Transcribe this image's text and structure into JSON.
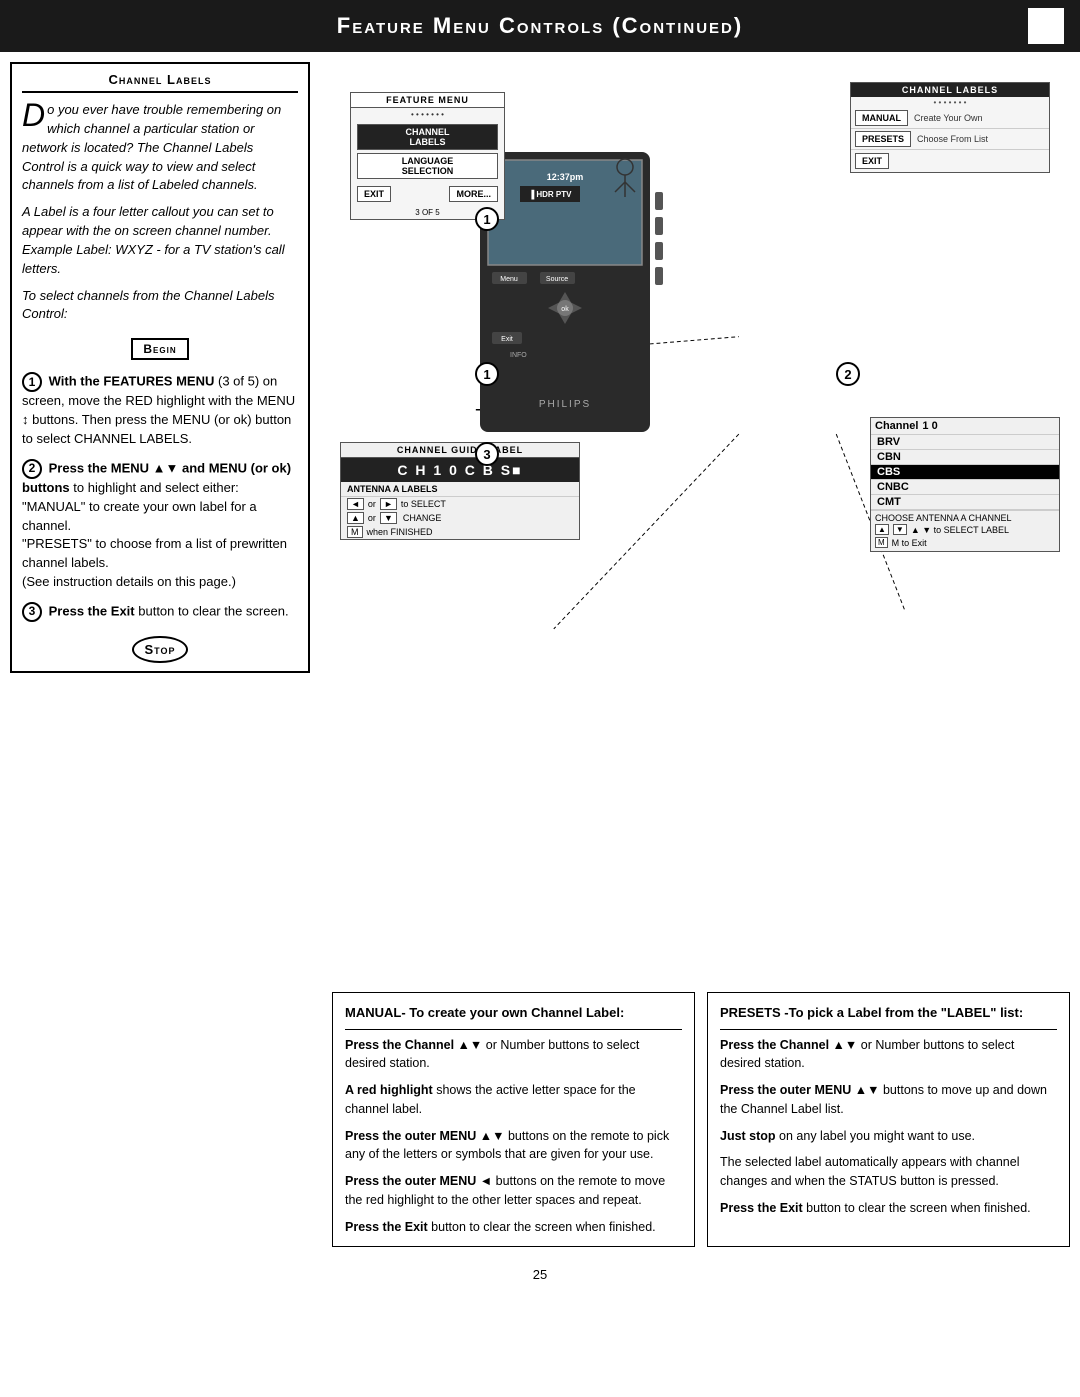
{
  "header": {
    "title": "Feature Menu Controls (Continued)",
    "corner": ""
  },
  "channel_labels_section": {
    "title": "Channel Labels",
    "intro_paragraph": "o you ever have trouble remembering on which channel a particular station or network is located? The Channel Labels Control is a quick way to view and select channels from a list of Labeled channels.",
    "intro_drop_cap": "D",
    "label_paragraph": "A Label is a four letter callout you can set to appear with the on screen channel number. Example Label: WXYZ - for a TV station's call letters.",
    "select_paragraph": "To select channels from the Channel Labels Control:",
    "begin_label": "Begin",
    "step1_header": "With the FEATURES MENU",
    "step1_text": "(3 of 5) on screen, move the RED highlight with the MENU ↕ buttons. Then press the MENU (or ok) button to select  CHANNEL LABELS.",
    "step2_header": "Press the MENU ▲▼ and MENU (or ok) buttons",
    "step2_text": " to highlight and select either:",
    "step2_manual": "\"MANUAL\" to create your own label for a channel.",
    "step2_presets": "\"PRESETS\" to choose from a list of prewritten channel labels.",
    "step2_note": "(See instruction details on this page.)",
    "step3_header": "Press the Exit",
    "step3_text": " button to clear the screen.",
    "stop_label": "Stop"
  },
  "feature_menu": {
    "title": "FEATURE MENU",
    "dots": "• • • • • • •",
    "items": [
      {
        "label": "CHANNEL\nLABELS",
        "selected": true
      },
      {
        "label": "LANGUAGE\nSELECTION",
        "selected": false
      }
    ],
    "exit_btn": "EXIT",
    "more_btn": "MORE...",
    "page_info": "3 OF 5"
  },
  "channel_labels_panel": {
    "title": "CHANNEL LABELS",
    "dots": "• • • • • • •",
    "manual_btn": "MANUAL",
    "manual_desc": "Create Your Own",
    "presets_btn": "PRESETS",
    "presets_desc": "Choose From List",
    "exit_btn": "EXIT"
  },
  "channel_guide": {
    "title": "CHANNEL GUIDE LABEL",
    "channel_display": "C H 1 0  C B S■",
    "antenna_label": "ANTENNA A LABELS",
    "instructions": [
      {
        "arrows": "◄ or ►",
        "action": "to SELECT"
      },
      {
        "arrows": "▲ or ▼",
        "action": "to CHANGE"
      },
      {
        "key": "M",
        "action": "when FINISHED"
      }
    ]
  },
  "presets_panel": {
    "channel_label": "Channel",
    "channel_num": "1 0",
    "labels": [
      "BRV",
      "CBN",
      "CBS",
      "CNBC",
      "CMT"
    ],
    "selected_label": "CBS",
    "choose_text": "CHOOSE ANTENNA A CHANNEL",
    "select_label_text": "▲ ▼ to SELECT LABEL",
    "exit_text": "M  to Exit"
  },
  "manual_instructions": {
    "title": "MANUAL- To create your own Channel Label:",
    "step1_bold": "Press the Channel ▲▼",
    "step1_text": " or Number buttons to select desired station.",
    "step2_bold": "A red highlight",
    "step2_text": " shows the active letter space for the channel label.",
    "step3_bold": "Press the outer MENU",
    "step3_text": " ▲▼ buttons on the remote to pick any of the letters or symbols that are given for your use.",
    "step4_bold": "Press the outer MENU ◄",
    "step4_text": " buttons on the remote to move the red highlight to the other letter spaces and repeat.",
    "step5_bold": "Press the Exit",
    "step5_text": " button to clear the screen when finished."
  },
  "presets_instructions": {
    "title": "PRESETS -To pick a Label from the \"LABEL\" list:",
    "step1_bold": "Press the Channel ▲▼",
    "step1_text": " or Number buttons to select desired station.",
    "step2_bold": "Press the outer MENU",
    "step2_text": " ▲▼ buttons to move up and down the Channel Label list.",
    "step3_bold": "Just stop",
    "step3_text": " on any label you might want to use.",
    "step4_text": "The selected label automatically appears with channel changes and when the STATUS button is pressed.",
    "step5_bold": "Press the Exit",
    "step5_text": " button to clear the screen when finished."
  },
  "page_number": "25",
  "change_text": "CHANGE"
}
